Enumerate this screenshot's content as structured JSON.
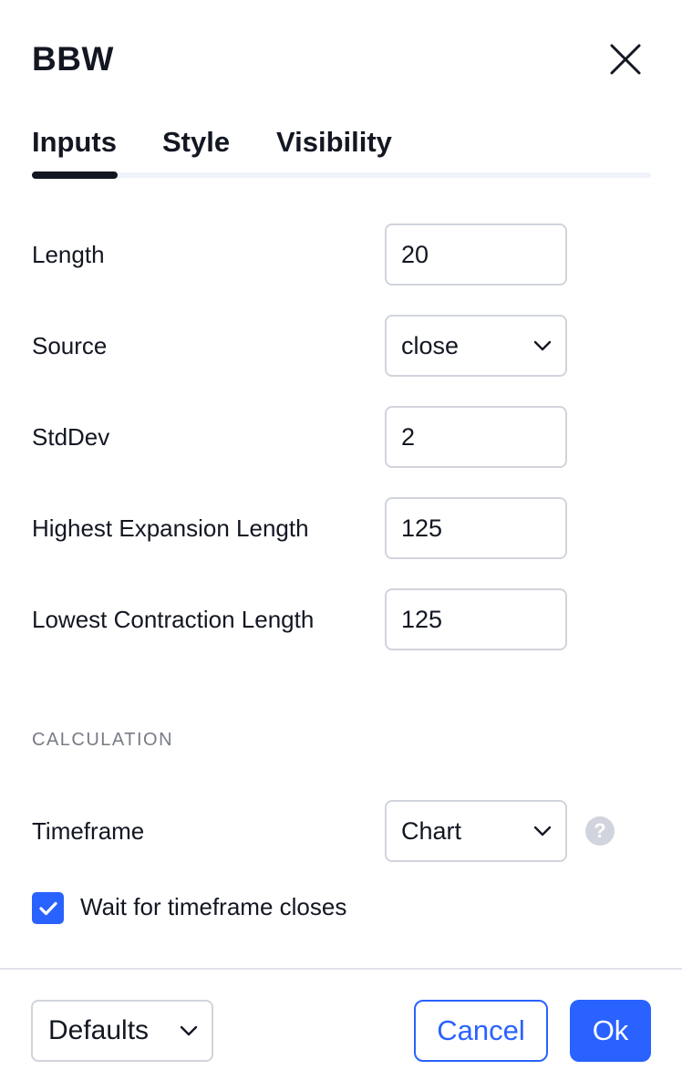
{
  "dialog": {
    "title": "BBW"
  },
  "tabs": [
    {
      "label": "Inputs",
      "active": true
    },
    {
      "label": "Style",
      "active": false
    },
    {
      "label": "Visibility",
      "active": false
    }
  ],
  "inputs": {
    "length": {
      "label": "Length",
      "value": "20"
    },
    "source": {
      "label": "Source",
      "value": "close"
    },
    "stddev": {
      "label": "StdDev",
      "value": "2"
    },
    "highest_expansion": {
      "label": "Highest Expansion Length",
      "value": "125"
    },
    "lowest_contraction": {
      "label": "Lowest Contraction Length",
      "value": "125"
    }
  },
  "calculation": {
    "section_title": "CALCULATION",
    "timeframe": {
      "label": "Timeframe",
      "value": "Chart"
    },
    "help_symbol": "?",
    "wait_for_close": {
      "label": "Wait for timeframe closes",
      "checked": true
    }
  },
  "footer": {
    "defaults_label": "Defaults",
    "cancel_label": "Cancel",
    "ok_label": "Ok"
  },
  "colors": {
    "accent": "#2962ff",
    "text": "#131722",
    "muted": "#787b86",
    "border": "#d1d4dc"
  }
}
